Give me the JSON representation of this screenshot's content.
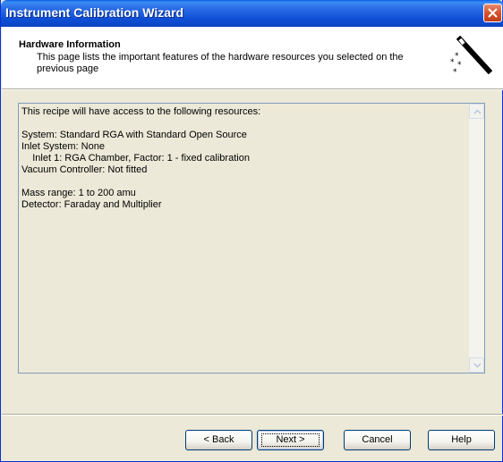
{
  "window": {
    "title": "Instrument Calibration Wizard"
  },
  "header": {
    "title": "Hardware Information",
    "description": "This page lists the important features of the hardware resources you selected on the previous page"
  },
  "resources_text": "This recipe will have access to the following resources:\n\nSystem: Standard RGA with Standard Open Source\nInlet System: None\n    Inlet 1: RGA Chamber, Factor: 1 - fixed calibration\nVacuum Controller: Not fitted\n\nMass range: 1 to 200 amu\nDetector: Faraday and Multiplier",
  "buttons": {
    "back": "< Back",
    "next": "Next >",
    "cancel": "Cancel",
    "help": "Help"
  },
  "icons": {
    "close": "close-icon",
    "wizard": "magic-wand-icon",
    "scroll_up": "scroll-up-arrow-icon",
    "scroll_down": "scroll-down-arrow-icon"
  }
}
